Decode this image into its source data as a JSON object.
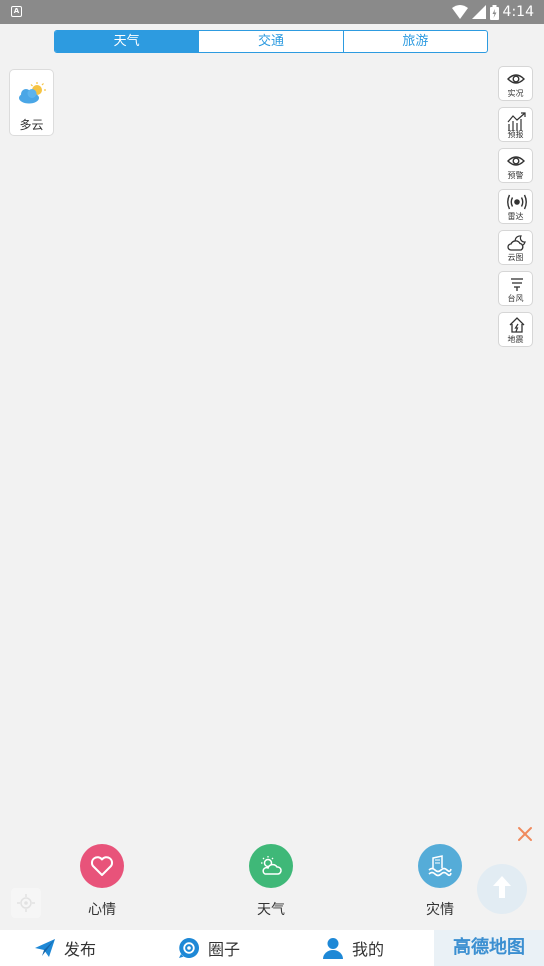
{
  "status_bar": {
    "left_icon_label": "A",
    "time": "4:14"
  },
  "tabs": [
    {
      "label": "天气",
      "active": true
    },
    {
      "label": "交通",
      "active": false
    },
    {
      "label": "旅游",
      "active": false
    }
  ],
  "weather": {
    "condition": "多云",
    "icon": "partly-cloudy-icon"
  },
  "tools": [
    {
      "label": "实况",
      "icon": "eye-icon"
    },
    {
      "label": "预报",
      "icon": "forecast-chart-icon"
    },
    {
      "label": "预警",
      "icon": "eye-icon"
    },
    {
      "label": "雷达",
      "icon": "radar-icon"
    },
    {
      "label": "云图",
      "icon": "cloud-moon-icon"
    },
    {
      "label": "台风",
      "icon": "typhoon-icon"
    },
    {
      "label": "地震",
      "icon": "house-quake-icon"
    }
  ],
  "actions": [
    {
      "label": "心情",
      "icon": "heart-icon",
      "color": "#e8537a"
    },
    {
      "label": "天气",
      "icon": "sun-cloud-icon",
      "color": "#3fb878"
    },
    {
      "label": "灾情",
      "icon": "flood-icon",
      "color": "#55acd8"
    }
  ],
  "close_color": "#f08a5d",
  "bottom_nav": [
    {
      "label": "发布",
      "icon": "paper-plane-icon"
    },
    {
      "label": "圈子",
      "icon": "circle-icon"
    },
    {
      "label": "我的",
      "icon": "person-icon"
    }
  ],
  "map_logo": "高德地图",
  "colors": {
    "accent": "#2d9be0",
    "nav_icon": "#1e88d6"
  }
}
